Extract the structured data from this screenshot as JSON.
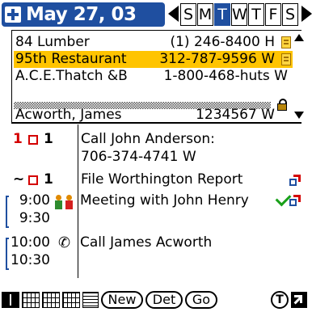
{
  "header": {
    "date": "May 27, 03",
    "weekdays": [
      "S",
      "M",
      "T",
      "W",
      "T",
      "F",
      "S"
    ],
    "selected_day": "T"
  },
  "contacts": [
    {
      "name": "84 Lumber",
      "phone": "(1) 246-8400 H",
      "note": true
    },
    {
      "name": "95th Restaurant",
      "phone": "312-787-9596 W",
      "note": true,
      "highlighted": true
    },
    {
      "name": "A.C.E.Thatch &B",
      "phone": "1-800-468-huts W"
    },
    {
      "name": "Acworth, James",
      "phone": "1234567 W"
    }
  ],
  "agenda": {
    "tasks": [
      {
        "priority": "1",
        "prefix": "1",
        "title": "Call John Anderson:",
        "detail": "706-374-4741 W"
      },
      {
        "priority": "1",
        "prefix": "~",
        "title": "File Worthington Report"
      }
    ],
    "events": [
      {
        "start": "9:00",
        "end": "9:30",
        "title": "Meeting with John Henry",
        "icon": "meeting-icon",
        "done": true
      },
      {
        "start": "10:00",
        "end": "10:30",
        "title": "Call James Acworth",
        "icon": "phone-icon"
      }
    ]
  },
  "toolbar": {
    "new_label": "New",
    "details_label": "Det",
    "go_label": "Go",
    "t_label": "T"
  },
  "colors": {
    "accent": "#1f4fa0",
    "highlight": "#ffc400",
    "priority": "#d40000",
    "done": "#19a019"
  }
}
